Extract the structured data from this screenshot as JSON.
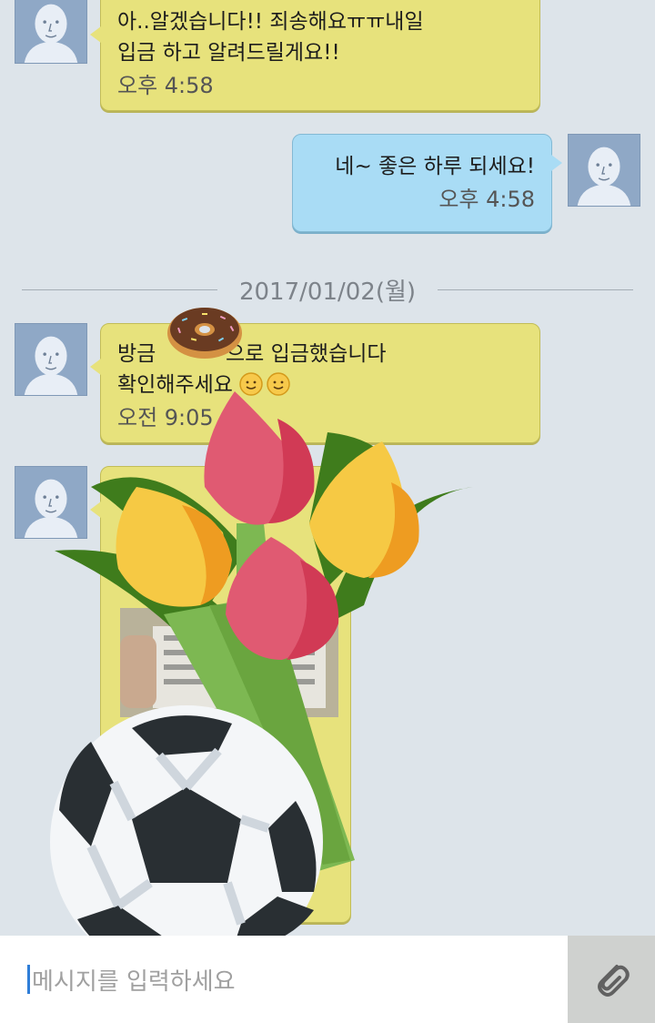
{
  "messages": [
    {
      "side": "in",
      "lines": [
        "아..알겠습니다!! 죄송해요ㅠㅠ내일",
        "입금 하고 알려드릴게요!!"
      ],
      "time": "오후 4:58"
    },
    {
      "side": "out",
      "lines": [
        "네~ 좋은 하루 되세요!"
      ],
      "time": "오후 4:58"
    },
    {
      "side": "in",
      "lines": [
        "방금",
        "으로 입금했습니다",
        "확인해주세요"
      ],
      "time": "오전 9:05"
    },
    {
      "side": "in",
      "type": "photo"
    }
  ],
  "date_divider": "2017/01/02(월)",
  "input": {
    "placeholder": "메시지를 입력하세요"
  },
  "icons": {
    "avatar": "default-avatar-icon",
    "attach": "paperclip-icon",
    "smiley": "smiley-icon",
    "donut_sticker": "donut-sticker-icon",
    "tulip_sticker": "tulip-bouquet-sticker-icon",
    "ball_sticker": "soccer-ball-sticker-icon"
  },
  "colors": {
    "background": "#dde4ea",
    "bubble_in": "#e7e27c",
    "bubble_out": "#a9dcf5",
    "avatar": "#8fa8c6",
    "caret": "#2f7ed8"
  }
}
